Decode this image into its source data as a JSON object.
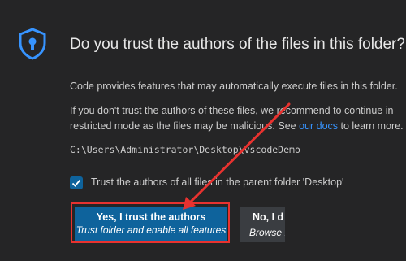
{
  "dialog": {
    "title": "Do you trust the authors of the files in this folder?",
    "message_1": "Code provides features that may automatically execute files in this folder.",
    "message_2": "If you don't trust the authors of these files, we recommend to continue in",
    "message_3_before": "restricted mode as the files may be malicious. See ",
    "message_3_link": "our docs",
    "message_3_after": " to learn more.",
    "folder_path": "C:\\Users\\Administrator\\Desktop\\vscodeDemo",
    "checkbox_label": "Trust the authors of all files in the parent folder 'Desktop'",
    "checkbox_checked": true,
    "trust_button": {
      "label": "Yes, I trust the authors",
      "sublabel": "Trust folder and enable all features"
    },
    "distrust_button": {
      "label": "No, I d",
      "sublabel": "Browse f"
    }
  },
  "colors": {
    "background": "#252526",
    "accent": "#0e639c",
    "link": "#3794ff",
    "annotation": "#e8322f"
  },
  "icons": {
    "header": "shield-lock-icon",
    "checkbox": "checkmark-icon"
  }
}
